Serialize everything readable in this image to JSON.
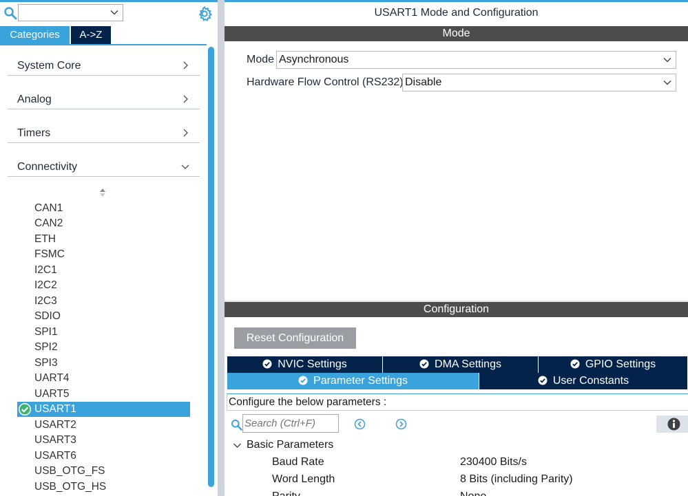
{
  "sidebar": {
    "category_combo_value": "",
    "tabs": [
      "Categories",
      "A->Z"
    ],
    "categories": [
      {
        "label": "System Core",
        "state": "collapsed"
      },
      {
        "label": "Analog",
        "state": "collapsed"
      },
      {
        "label": "Timers",
        "state": "collapsed"
      },
      {
        "label": "Connectivity",
        "state": "expanded"
      }
    ],
    "peripherals": [
      "CAN1",
      "CAN2",
      "ETH",
      "FSMC",
      "I2C1",
      "I2C2",
      "I2C3",
      "SDIO",
      "SPI1",
      "SPI2",
      "SPI3",
      "UART4",
      "UART5",
      "USART1",
      "USART2",
      "USART3",
      "USART6",
      "USB_OTG_FS",
      "USB_OTG_HS"
    ],
    "selected": "USART1"
  },
  "main": {
    "title": "USART1 Mode and Configuration",
    "mode_section": "Mode",
    "mode_label": "Mode",
    "mode_value": "Asynchronous",
    "hfc_label": "Hardware Flow Control (RS232)",
    "hfc_value": "Disable",
    "config_section": "Configuration",
    "reset_button": "Reset Configuration",
    "tabs": {
      "nvic": "NVIC Settings",
      "dma": "DMA Settings",
      "gpio": "GPIO Settings",
      "param": "Parameter Settings",
      "user": "User Constants"
    },
    "active_tab": "Parameter Settings",
    "hint": "Configure the below parameters :",
    "search_placeholder": "Search (Ctrl+F)",
    "group_label": "Basic Parameters",
    "params": [
      {
        "name": "Baud Rate",
        "value": "230400 Bits/s"
      },
      {
        "name": "Word Length",
        "value": "8 Bits (including Parity)"
      },
      {
        "name": "Parity",
        "value": "None"
      }
    ]
  },
  "colors": {
    "accent": "#3aa3dc",
    "navy": "#03234b",
    "section_header": "#4d4d4d",
    "button_gray": "#9a9ea3"
  }
}
